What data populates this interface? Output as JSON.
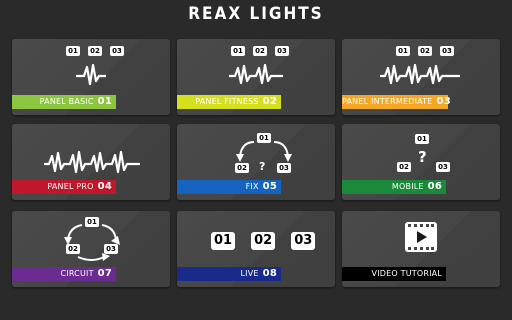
{
  "app": {
    "title": "REAX LIGHTS"
  },
  "tiles": [
    {
      "label": "PANEL BASIC",
      "num": "01",
      "color": "#8cc63f",
      "boxes": [
        "01",
        "02",
        "03"
      ]
    },
    {
      "label": "PANEL FITNESS",
      "num": "02",
      "color": "#d4e01e",
      "boxes": [
        "01",
        "02",
        "03"
      ]
    },
    {
      "label": "PANEL INTERMEDIATE",
      "num": "03",
      "color": "#f5a623",
      "boxes": [
        "01",
        "02",
        "03"
      ]
    },
    {
      "label": "PANEL PRO",
      "num": "04",
      "color": "#c0172d",
      "boxes": []
    },
    {
      "label": "FIX",
      "num": "05",
      "color": "#1565c0",
      "boxes": [
        "01",
        "02",
        "03"
      ],
      "mark": "?"
    },
    {
      "label": "MOBILE",
      "num": "06",
      "color": "#1a8a3a",
      "boxes": [
        "01",
        "02",
        "03"
      ],
      "mark": "?"
    },
    {
      "label": "CIRCUIT",
      "num": "07",
      "color": "#6a2c91",
      "boxes": [
        "01",
        "02",
        "03"
      ]
    },
    {
      "label": "LIVE",
      "num": "08",
      "color": "#1a2a8a",
      "boxes": [
        "01",
        "02",
        "03"
      ]
    },
    {
      "label": "VIDEO TUTORIAL",
      "num": "",
      "color": "#000000",
      "boxes": []
    }
  ]
}
